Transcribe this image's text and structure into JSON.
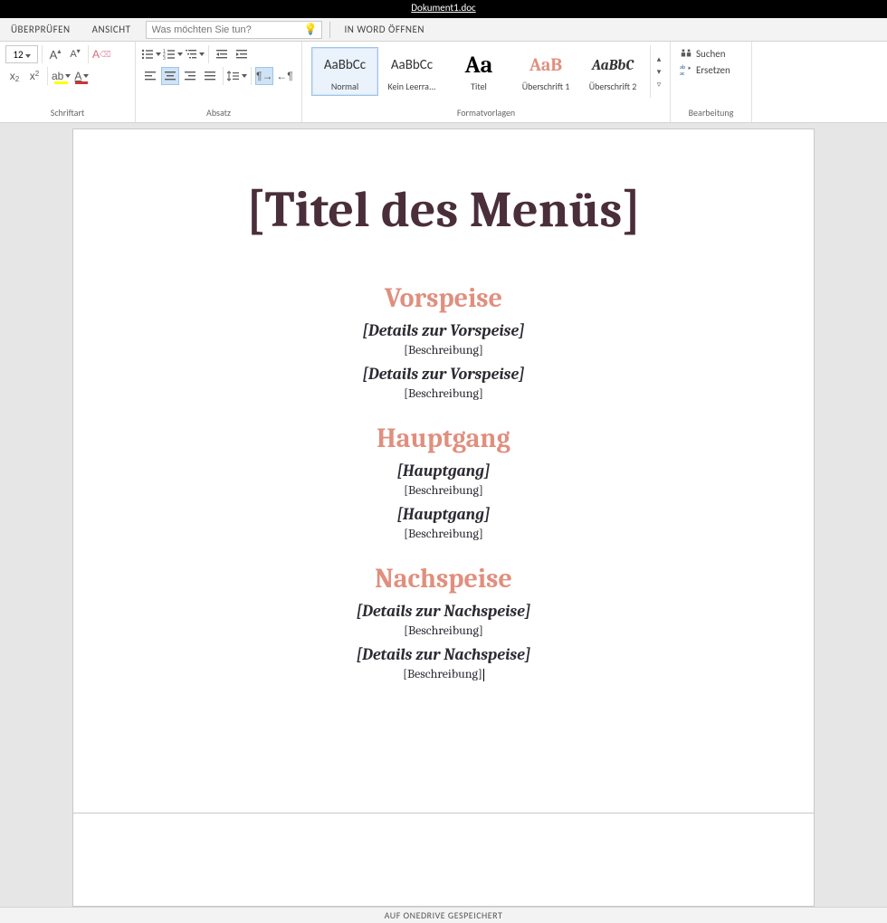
{
  "titlebar": {
    "doc": "Dokument1.doc"
  },
  "tabs": {
    "review": "ÜBERPRÜFEN",
    "view": "ANSICHT",
    "tellme_placeholder": "Was möchten Sie tun?",
    "open_in_word": "IN WORD ÖFFNEN"
  },
  "ribbon": {
    "font_group": "Schriftart",
    "font_size": "12",
    "paragraph_group": "Absatz",
    "styles_group": "Formatvorlagen",
    "editing_group": "Bearbeitung",
    "styles": [
      {
        "sample": "AaBbCc",
        "name": "Normal",
        "css": "color:#333;font-size:15px;"
      },
      {
        "sample": "AaBbCc",
        "name": "Kein Leerra...",
        "css": "color:#333;font-size:15px;"
      },
      {
        "sample": "Aa",
        "name": "Titel",
        "css": "color:#000;font-size:26px;font-weight:bold;font-family:Cambria,Georgia,serif;"
      },
      {
        "sample": "AaB",
        "name": "Überschrift 1",
        "css": "color:#e08f7e;font-size:20px;font-weight:bold;font-family:Cambria,Georgia,serif;"
      },
      {
        "sample": "AaBbC",
        "name": "Überschrift 2",
        "css": "color:#333;font-size:16px;font-weight:bold;font-style:italic;font-family:Cambria,Georgia,serif;"
      }
    ],
    "find": "Suchen",
    "replace": "Ersetzen"
  },
  "document": {
    "title": "[Titel des Menüs]",
    "sections": [
      {
        "heading": "Vorspeise",
        "items": [
          {
            "h": "[Details zur Vorspeise]",
            "d": "[Beschreibung]"
          },
          {
            "h": "[Details zur Vorspeise]",
            "d": "[Beschreibung]"
          }
        ]
      },
      {
        "heading": "Hauptgang",
        "items": [
          {
            "h": "[Hauptgang]",
            "d": "[Beschreibung]"
          },
          {
            "h": "[Hauptgang]",
            "d": "[Beschreibung]"
          }
        ]
      },
      {
        "heading": "Nachspeise",
        "items": [
          {
            "h": "[Details zur Nachspeise]",
            "d": "[Beschreibung]"
          },
          {
            "h": "[Details zur Nachspeise]",
            "d": "[Beschreibung]"
          }
        ]
      }
    ]
  },
  "statusbar": {
    "saved": "AUF ONEDRIVE GESPEICHERT"
  }
}
